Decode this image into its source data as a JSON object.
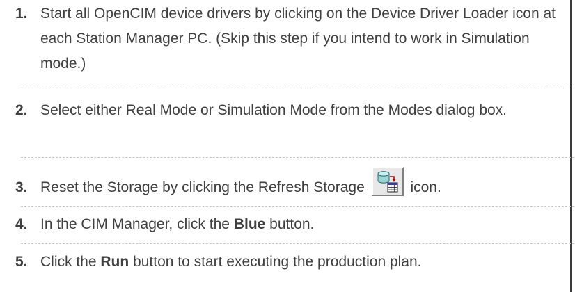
{
  "steps": [
    {
      "number": "1.",
      "text": "Start all OpenCIM device drivers by clicking on the Device Driver Loader icon at each Station Manager PC. (Skip this step if you intend to work in Simulation mode.)"
    },
    {
      "number": "2.",
      "text": "Select either Real Mode or Simulation Mode from the Modes dialog box."
    },
    {
      "number": "3.",
      "before": "Reset the Storage by clicking the Refresh Storage",
      "icon": "refresh-storage-icon",
      "after": "icon."
    },
    {
      "number": "4.",
      "before": "In the CIM Manager, click the",
      "bold": "Blue",
      "after": "button."
    },
    {
      "number": "5.",
      "before": "Click the",
      "bold": "Run",
      "after": "button to start executing the production plan."
    }
  ]
}
